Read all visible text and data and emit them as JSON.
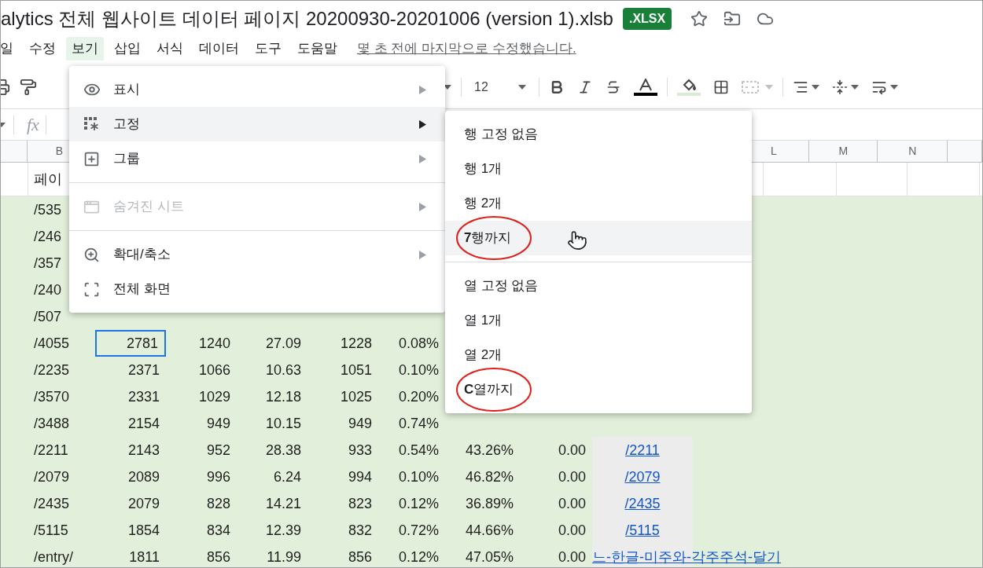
{
  "title": "alytics 전체 웹사이트 데이터 페이지 20200930-20201006 (version 1).xlsb",
  "badge": ".XLSX",
  "menu_bar": {
    "items": [
      {
        "label": "일",
        "selected": false
      },
      {
        "label": "수정",
        "selected": false
      },
      {
        "label": "보기",
        "selected": true
      },
      {
        "label": "삽입",
        "selected": false
      },
      {
        "label": "서식",
        "selected": false
      },
      {
        "label": "데이터",
        "selected": false
      },
      {
        "label": "도구",
        "selected": false
      },
      {
        "label": "도움말",
        "selected": false
      }
    ],
    "last_edit": "몇 초 전에 마지막으로 수정했습니다."
  },
  "toolbar": {
    "font_size": "12",
    "merge_disabled": true
  },
  "formula_bar": {
    "label": "fx"
  },
  "column_headers": [
    "B",
    "L",
    "M",
    "N"
  ],
  "rows": [
    {
      "kind": "header",
      "cells": [
        "페이"
      ]
    },
    {
      "kind": "data",
      "cells": [
        "/535"
      ]
    },
    {
      "kind": "data",
      "cells": [
        "/246"
      ]
    },
    {
      "kind": "data",
      "cells": [
        "/357"
      ]
    },
    {
      "kind": "data",
      "cells": [
        "/240"
      ]
    },
    {
      "kind": "data",
      "cells": [
        "/507"
      ]
    },
    {
      "kind": "data",
      "cells": [
        "/4055",
        {
          "text": "2781",
          "selected": true
        },
        "1240",
        "27.09",
        "1228",
        "0.08%"
      ]
    },
    {
      "kind": "data",
      "cells": [
        "/2235",
        "2371",
        "1066",
        "10.63",
        "1051",
        "0.10%"
      ]
    },
    {
      "kind": "data",
      "cells": [
        "/3570",
        "2331",
        "1029",
        "12.18",
        "1025",
        "0.20%"
      ]
    },
    {
      "kind": "data",
      "cells": [
        "/3488",
        "2154",
        "949",
        "10.15",
        "949",
        "0.74%"
      ]
    },
    {
      "kind": "data",
      "cells": [
        "/2211",
        "2143",
        "952",
        "28.38",
        "933",
        "0.54%",
        "43.26%",
        "0.00"
      ],
      "link": "/2211"
    },
    {
      "kind": "data",
      "cells": [
        "/2079",
        "2089",
        "996",
        "6.24",
        "994",
        "0.10%",
        "46.82%",
        "0.00"
      ],
      "link": "/2079"
    },
    {
      "kind": "data",
      "cells": [
        "/2435",
        "2079",
        "828",
        "14.21",
        "823",
        "0.12%",
        "36.89%",
        "0.00"
      ],
      "link": "/2435"
    },
    {
      "kind": "data",
      "cells": [
        "/5115",
        "1854",
        "834",
        "12.39",
        "832",
        "0.72%",
        "44.66%",
        "0.00"
      ],
      "link": "/5115"
    },
    {
      "kind": "data",
      "cells": [
        "/entry/",
        "1811",
        "856",
        "11.99",
        "856",
        "0.12%",
        "47.05%",
        "0.00"
      ],
      "link": "느-한글-미주와-각주주석-달기"
    }
  ],
  "view_menu": {
    "items": [
      {
        "kind": "item",
        "label": "표시",
        "highlighted": false,
        "disabled": false,
        "submenu": true
      },
      {
        "kind": "item",
        "label": "고정",
        "highlighted": true,
        "disabled": false,
        "submenu": true
      },
      {
        "kind": "item",
        "label": "그룹",
        "highlighted": false,
        "disabled": false,
        "submenu": true
      },
      {
        "kind": "divider"
      },
      {
        "kind": "item",
        "label": "숨겨진 시트",
        "highlighted": false,
        "disabled": true,
        "submenu": true
      },
      {
        "kind": "divider"
      },
      {
        "kind": "item",
        "label": "확대/축소",
        "highlighted": false,
        "disabled": false,
        "submenu": true
      },
      {
        "kind": "item",
        "label": "전체 화면",
        "highlighted": false,
        "disabled": false,
        "submenu": false
      }
    ]
  },
  "freeze_submenu": {
    "items": [
      {
        "kind": "item",
        "label": "행 고정 없음",
        "highlighted": false,
        "circled": false
      },
      {
        "kind": "item",
        "label": "행 1개",
        "highlighted": false,
        "circled": false
      },
      {
        "kind": "item",
        "label": "행 2개",
        "highlighted": false,
        "circled": false
      },
      {
        "kind": "item",
        "label": "**7**행까지",
        "highlighted": true,
        "circled": true
      },
      {
        "kind": "divider"
      },
      {
        "kind": "item",
        "label": "열 고정 없음",
        "highlighted": false,
        "circled": false
      },
      {
        "kind": "item",
        "label": "열 1개",
        "highlighted": false,
        "circled": false
      },
      {
        "kind": "item",
        "label": "열 2개",
        "highlighted": false,
        "circled": false
      },
      {
        "kind": "item",
        "label": "**C**열까지",
        "highlighted": false,
        "circled": true
      }
    ]
  }
}
